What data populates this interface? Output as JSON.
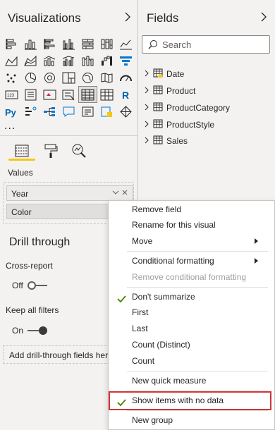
{
  "visualizations": {
    "title": "Visualizations",
    "icons": [
      "stacked-bar-chart-icon",
      "stacked-column-chart-icon",
      "clustered-bar-chart-icon",
      "clustered-column-chart-icon",
      "100-stacked-bar-chart-icon",
      "100-stacked-column-chart-icon",
      "line-chart-icon",
      "area-chart-icon",
      "stacked-area-chart-icon",
      "line-and-stacked-column-chart-icon",
      "line-and-clustered-column-chart-icon",
      "ribbon-chart-icon",
      "waterfall-chart-icon",
      "funnel-chart-icon",
      "scatter-chart-icon",
      "pie-chart-icon",
      "donut-chart-icon",
      "treemap-icon",
      "map-icon",
      "filled-map-icon",
      "gauge-icon",
      "card-icon",
      "multi-row-card-icon",
      "kpi-icon",
      "slicer-icon",
      "table-icon",
      "matrix-icon",
      "r-script-visual-icon",
      "python-visual-icon",
      "key-influencers-icon",
      "decomposition-tree-icon",
      "qa-icon",
      "smart-narrative-icon",
      "paginated-report-icon",
      "power-apps-icon"
    ],
    "more": "...",
    "tabs": [
      "fields-tab",
      "format-tab",
      "analytics-tab"
    ],
    "values_label": "Values",
    "values_fields": [
      "Year",
      "Color"
    ],
    "drill_through_title": "Drill through",
    "cross_report_label": "Cross-report",
    "cross_report_state": "Off",
    "keep_filters_label": "Keep all filters",
    "keep_filters_state": "On",
    "drill_add_placeholder": "Add drill-through fields here"
  },
  "fields": {
    "title": "Fields",
    "search_placeholder": "Search",
    "tables": [
      "Date",
      "Product",
      "ProductCategory",
      "ProductStyle",
      "Sales"
    ]
  },
  "context_menu": {
    "items": [
      {
        "label": "Remove field",
        "disabled": false
      },
      {
        "label": "Rename for this visual",
        "disabled": false
      },
      {
        "label": "Move",
        "disabled": false,
        "submenu": true
      },
      {
        "label": "Conditional formatting",
        "disabled": false,
        "submenu": true
      },
      {
        "label": "Remove conditional formatting",
        "disabled": true
      },
      {
        "label": "Don't summarize",
        "checked": true
      },
      {
        "label": "First"
      },
      {
        "label": "Last"
      },
      {
        "label": "Count (Distinct)"
      },
      {
        "label": "Count"
      },
      {
        "label": "New quick measure"
      },
      {
        "label": "Show items with no data",
        "checked": true,
        "highlighted": true
      },
      {
        "label": "New group"
      }
    ]
  },
  "colors": {
    "accent_yellow": "#f2c811",
    "check_green": "#498205",
    "highlight_red": "#d13438",
    "date_badge": "#f2c811"
  }
}
